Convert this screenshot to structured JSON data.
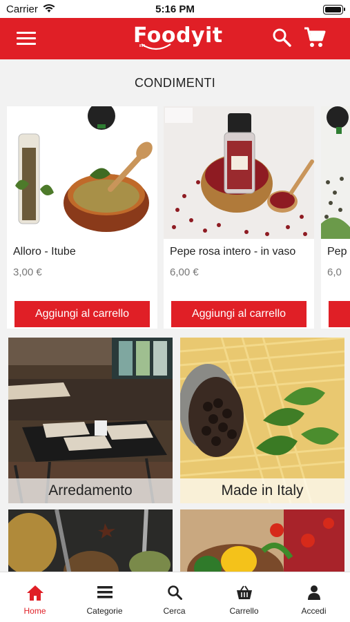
{
  "status_bar": {
    "carrier": "Carrier",
    "time": "5:16 PM"
  },
  "header": {
    "logo_text": "Foodyit",
    "accent_color": "#e01f26"
  },
  "section": {
    "title": "CONDIMENTI"
  },
  "products": [
    {
      "name": "Alloro - Itube",
      "price": "3,00 €",
      "button": "Aggiungi al carrello"
    },
    {
      "name": "Pepe rosa intero - in vaso",
      "price": "6,00 €",
      "button": "Aggiungi al carrello"
    },
    {
      "name": "Pep",
      "price": "6,0",
      "button": ""
    }
  ],
  "categories": [
    {
      "label": "Arredamento"
    },
    {
      "label": "Made in Italy"
    },
    {
      "label": ""
    },
    {
      "label": ""
    }
  ],
  "tabs": [
    {
      "label": "Home",
      "icon": "home-icon",
      "active": true
    },
    {
      "label": "Categorie",
      "icon": "menu-icon",
      "active": false
    },
    {
      "label": "Cerca",
      "icon": "search-icon",
      "active": false
    },
    {
      "label": "Carrello",
      "icon": "basket-icon",
      "active": false
    },
    {
      "label": "Accedi",
      "icon": "user-icon",
      "active": false
    }
  ]
}
